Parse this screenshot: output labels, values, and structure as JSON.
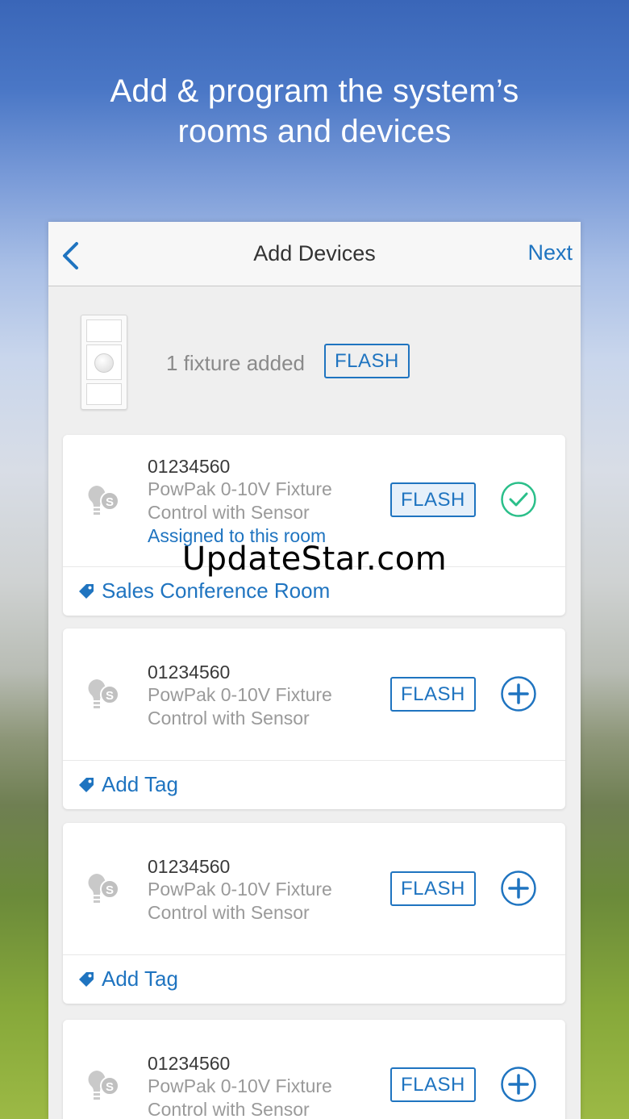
{
  "headline": {
    "line1": "Add & program the system’s",
    "line2": "rooms and devices"
  },
  "navbar": {
    "back_icon": "chevron-left-icon",
    "title": "Add Devices",
    "next_label": "Next"
  },
  "summary": {
    "device_image": "keypad-image",
    "text": "1 fixture added",
    "flash_label": "FLASH"
  },
  "devices": [
    {
      "serial": "01234560",
      "name_line1": "PowPak 0-10V Fixture",
      "name_line2": "Control with Sensor",
      "assigned": "Assigned to this room",
      "flash_label": "FLASH",
      "status": "check-icon",
      "tag_label": "Sales Conference Room"
    },
    {
      "serial": "01234560",
      "name_line1": "PowPak 0-10V Fixture",
      "name_line2": "Control with Sensor",
      "flash_label": "FLASH",
      "status": "add-icon",
      "tag_label": "Add Tag"
    },
    {
      "serial": "01234560",
      "name_line1": "PowPak 0-10V Fixture",
      "name_line2": "Control with Sensor",
      "flash_label": "FLASH",
      "status": "add-icon",
      "tag_label": "Add Tag"
    },
    {
      "serial": "01234560",
      "name_line1": "PowPak 0-10V Fixture",
      "name_line2": "Control with Sensor",
      "flash_label": "FLASH",
      "status": "add-icon"
    }
  ],
  "watermark": "UpdateStar.com",
  "colors": {
    "accent": "#1f74c0",
    "success": "#2bbf8a"
  }
}
